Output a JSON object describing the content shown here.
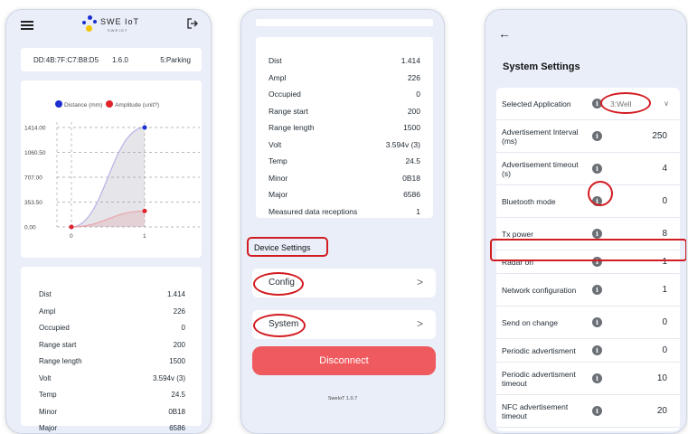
{
  "dashboard": {
    "device_id": "DD:4B:7F:C7:B8:D5",
    "firmware": "1.6.0",
    "mode": "5:Parking",
    "logo_text": "SWE IoT",
    "logo_sub": "S W E  I O T",
    "legend": {
      "distance": "Distance (mm)",
      "amplitude": "Amplitude (unit?)"
    },
    "colors": {
      "distance": "#1b2fd0",
      "amplitude": "#e0222a",
      "accent": "#ef5a5e"
    },
    "values": [
      {
        "key": "Dist",
        "value": "1.414"
      },
      {
        "key": "Ampl",
        "value": "226"
      },
      {
        "key": "Occupied",
        "value": "0"
      },
      {
        "key": "Range start",
        "value": "200"
      },
      {
        "key": "Range length",
        "value": "1500"
      },
      {
        "key": "Volt",
        "value": "3.594v (3)"
      },
      {
        "key": "Temp",
        "value": "24.5"
      },
      {
        "key": "Minor",
        "value": "0B18"
      },
      {
        "key": "Major",
        "value": "6586"
      }
    ]
  },
  "chart_data": {
    "type": "area",
    "x": [
      0,
      1
    ],
    "xticks": [
      "0",
      "1"
    ],
    "yticks": [
      "0.00",
      "353.50",
      "707.00",
      "1060.50",
      "1414.00"
    ],
    "ylim": [
      0,
      1414
    ],
    "series": [
      {
        "name": "Distance (mm)",
        "values": [
          0,
          1414
        ],
        "color": "#1b2fd0"
      },
      {
        "name": "Amplitude (unit?)",
        "values": [
          0,
          226
        ],
        "color": "#e0222a"
      }
    ],
    "grid": true,
    "legend": "top"
  },
  "device": {
    "values": [
      {
        "key": "Dist",
        "value": "1.414"
      },
      {
        "key": "Ampl",
        "value": "226"
      },
      {
        "key": "Occupied",
        "value": "0"
      },
      {
        "key": "Range start",
        "value": "200"
      },
      {
        "key": "Range length",
        "value": "1500"
      },
      {
        "key": "Volt",
        "value": "3.594v (3)"
      },
      {
        "key": "Temp",
        "value": "24.5"
      },
      {
        "key": "Minor",
        "value": "0B18"
      },
      {
        "key": "Major",
        "value": "6586"
      },
      {
        "key": "Measured data receptions",
        "value": "1"
      }
    ],
    "section_title": "Device Settings",
    "config_label": "Config",
    "system_label": "System",
    "disconnect_label": "Disconnect",
    "version": "SweIoT 1.0.7"
  },
  "system_settings": {
    "title": "System Settings",
    "rows": [
      {
        "label": "Selected Application",
        "value": "3:Well"
      },
      {
        "label": "Advertisement Interval (ms)",
        "value": "250"
      },
      {
        "label": "Advertisement timeout (s)",
        "value": "4"
      },
      {
        "label": "Bluetooth mode",
        "value": "0"
      },
      {
        "label": "Tx power",
        "value": "8"
      },
      {
        "label": "Radar on",
        "value": "1"
      },
      {
        "label": "Network configuration",
        "value": "1"
      },
      {
        "label": "Send on change",
        "value": "0"
      },
      {
        "label": "Periodic advertisment",
        "value": "0"
      },
      {
        "label": "Periodic advertisment timeout",
        "value": "10"
      },
      {
        "label": "NFC advertisement timeout",
        "value": "20"
      }
    ]
  }
}
